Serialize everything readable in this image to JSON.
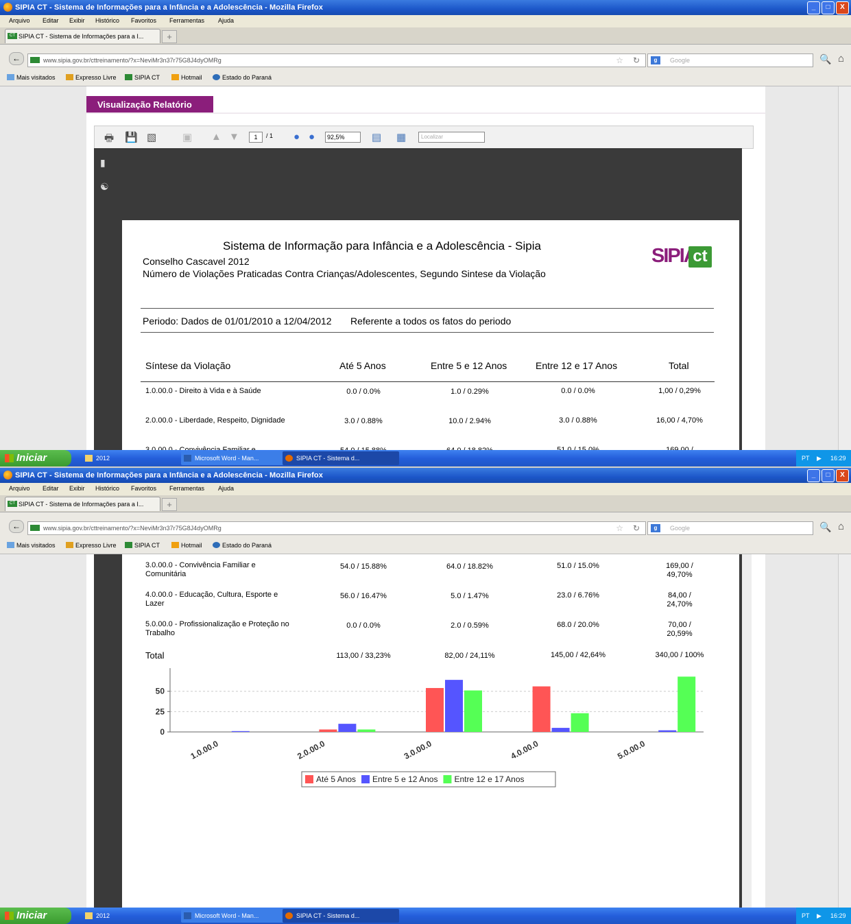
{
  "window": {
    "title": "SIPIA CT - Sistema de Informações para a Infância e a Adolescência - Mozilla Firefox",
    "buttons": [
      "_",
      "□",
      "X"
    ]
  },
  "menu": [
    "Arquivo",
    "Editar",
    "Exibir",
    "Histórico",
    "Favoritos",
    "Ferramentas",
    "Ajuda"
  ],
  "tab": {
    "label": "SIPIA CT - Sistema de Informações para a I...",
    "favicon": "CT",
    "new_tab": "+"
  },
  "nav": {
    "url": "www.sipia.gov.br/cttreinamento/?x=NeviMr3n37r75G8J4dyOMRg",
    "search_placeholder": "Google",
    "search_engine": "g"
  },
  "bookmarks": [
    "Mais visitados",
    "Expresso Livre",
    "SIPIA CT",
    "Hotmail",
    "Estado do Paraná"
  ],
  "page": {
    "header": "Visualização Relatório",
    "viewer": {
      "page_current": "1",
      "page_total": "/ 1",
      "zoom": "92,5%",
      "find_placeholder": "Localizar"
    }
  },
  "report": {
    "title": "Sistema de Informação para Infância e a Adolescência - Sipia",
    "council": "Conselho Cascavel 2012",
    "subtitle": "Número de Violações Praticadas Contra Crianças/Adolescentes, Segundo Sintese da Violação",
    "logo_text": "SIPIA",
    "logo_ct": "ct",
    "period": "Periodo: Dados de 01/01/2010 a 12/04/2012",
    "period_ref": "Referente a todos os fatos do periodo",
    "columns": [
      "Síntese da Violação",
      "Até 5 Anos",
      "Entre 5 e 12 Anos",
      "Entre 12 e 17 Anos",
      "Total"
    ],
    "rows": [
      {
        "label": "1.0.00.0 - Direito à Vida e à Saúde",
        "a": "0.0 / 0.0%",
        "b": "1.0 / 0.29%",
        "c": "0.0 / 0.0%",
        "t": "1,00 / 0,29%"
      },
      {
        "label": "2.0.00.0 - Liberdade, Respeito, Dignidade",
        "a": "3.0 / 0.88%",
        "b": "10.0 / 2.94%",
        "c": "3.0 / 0.88%",
        "t": "16,00 / 4,70%"
      },
      {
        "label": "3.0.00.0 - Convivência Familiar e Comunitária",
        "a": "54.0 / 15.88%",
        "b": "64.0 / 18.82%",
        "c": "51.0 / 15.0%",
        "t": "169,00 / 49,70%"
      },
      {
        "label": "4.0.00.0 - Educação, Cultura, Esporte e Lazer",
        "a": "56.0 / 16.47%",
        "b": "5.0 / 1.47%",
        "c": "23.0 / 6.76%",
        "t": "84,00 / 24,70%"
      },
      {
        "label": "5.0.00.0 - Profissionalização e Proteção no Trabalho",
        "a": "0.0 / 0.0%",
        "b": "2.0 / 0.59%",
        "c": "68.0 / 20.0%",
        "t": "70,00 / 20,59%"
      }
    ],
    "partial_row": {
      "label": "3.0.00.0 - Convivência Familiar e",
      "a": "54.0 / 15.88%",
      "b": "64.0 / 18.82%",
      "c": "51.0 / 15.0%",
      "t": "169,00 /"
    },
    "total": {
      "label": "Total",
      "a": "113,00 / 33,23%",
      "b": "82,00 / 24,11%",
      "c": "145,00 / 42,64%",
      "t": "340,00 / 100%"
    }
  },
  "chart_data": {
    "type": "bar",
    "categories": [
      "1.0.00.0",
      "2.0.00.0",
      "3.0.00.0",
      "4.0.00.0",
      "5.0.00.0"
    ],
    "series": [
      {
        "name": "Até 5 Anos",
        "color": "#ff5555",
        "values": [
          0,
          3,
          54,
          56,
          0
        ]
      },
      {
        "name": "Entre 5 e 12 Anos",
        "color": "#5555ff",
        "values": [
          1,
          10,
          64,
          5,
          2
        ]
      },
      {
        "name": "Entre 12 e 17 Anos",
        "color": "#55ff55",
        "values": [
          0,
          3,
          51,
          23,
          68
        ]
      }
    ],
    "yticks": [
      0,
      25,
      50
    ],
    "ylim": [
      0,
      70
    ],
    "grid": true,
    "legend": "bottom"
  },
  "taskbar": {
    "start": "Iniciar",
    "tasks": [
      "2012",
      "Microsoft Word - Man...",
      "SIPIA CT - Sistema d..."
    ],
    "lang": "PT",
    "clock": "16:29"
  }
}
